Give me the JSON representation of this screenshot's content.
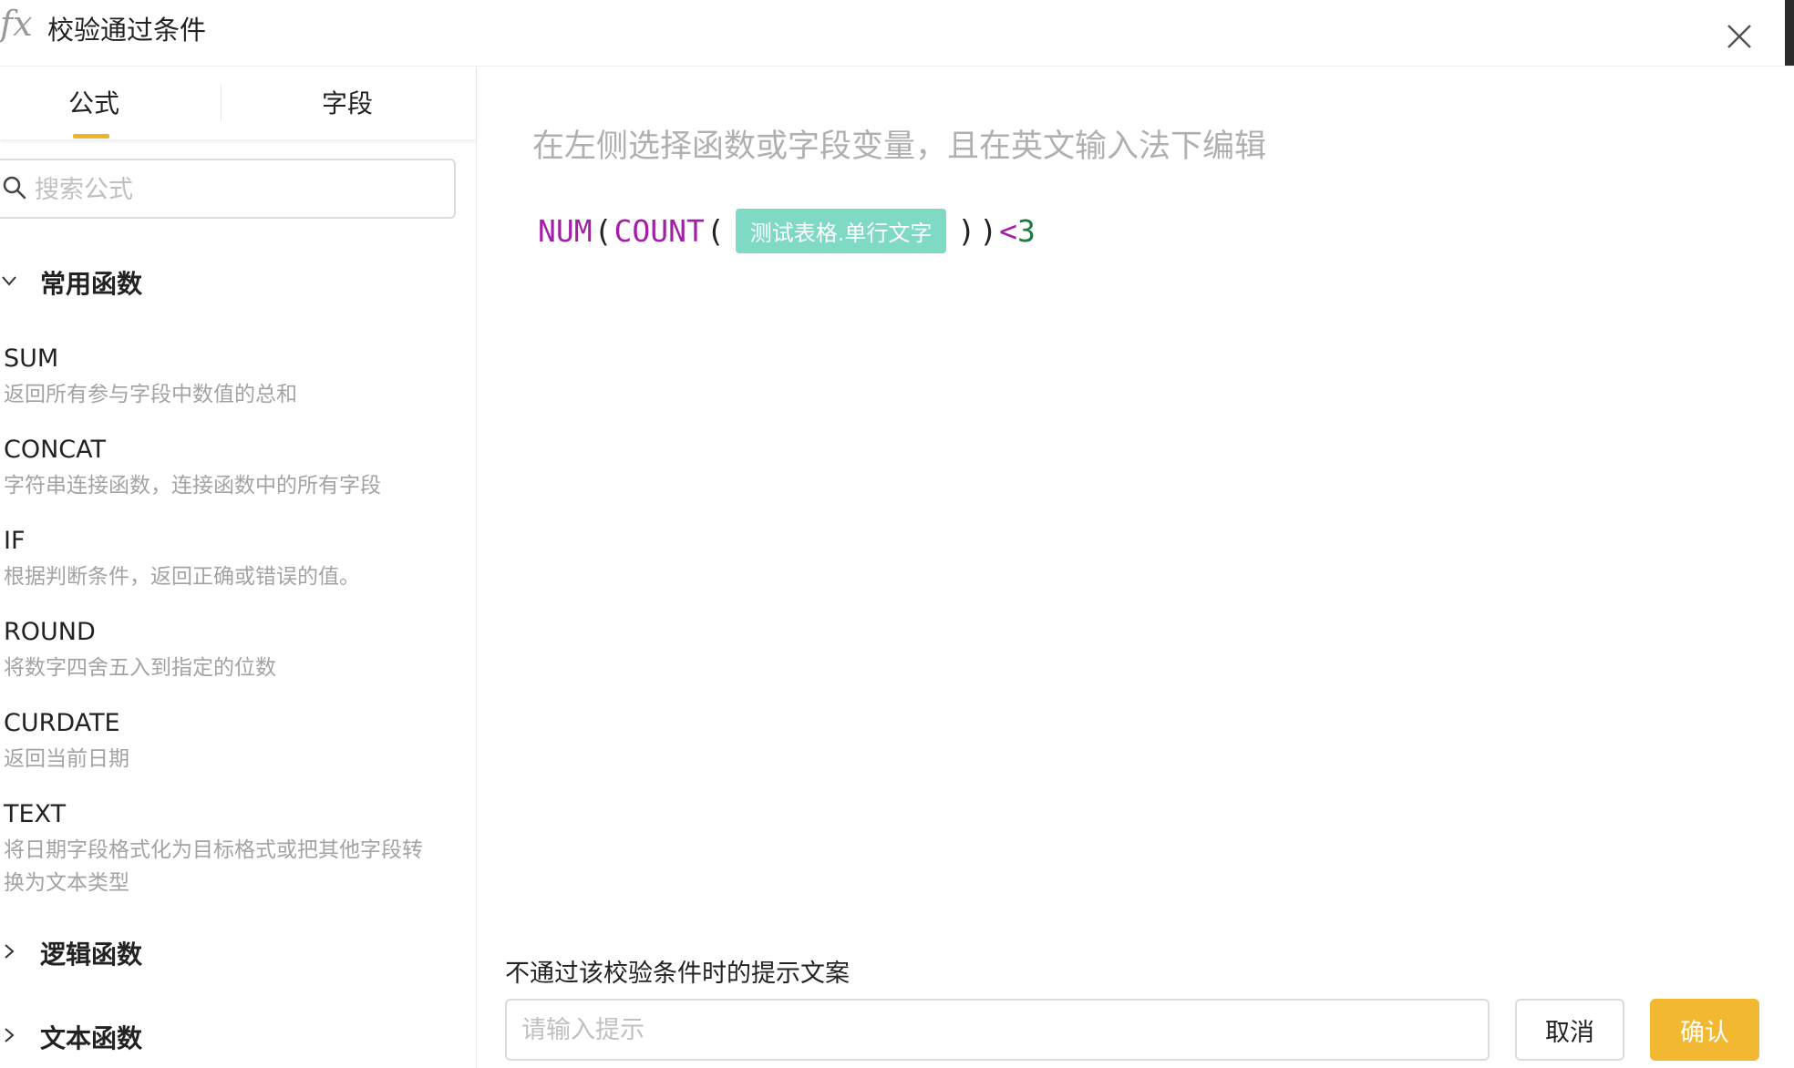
{
  "header": {
    "fx_icon": "fx",
    "title": "校验通过条件",
    "close_icon": "close-icon"
  },
  "tabs": [
    {
      "label": "公式",
      "active": true
    },
    {
      "label": "字段",
      "active": false
    }
  ],
  "search": {
    "placeholder": "搜索公式"
  },
  "groups": [
    {
      "label": "常用函数",
      "expanded": true
    },
    {
      "label": "逻辑函数",
      "expanded": false
    },
    {
      "label": "文本函数",
      "expanded": false
    }
  ],
  "functions": [
    {
      "name": "SUM",
      "desc": "返回所有参与字段中数值的总和"
    },
    {
      "name": "CONCAT",
      "desc": "字符串连接函数，连接函数中的所有字段"
    },
    {
      "name": "IF",
      "desc": "根据判断条件，返回正确或错误的值。"
    },
    {
      "name": "ROUND",
      "desc": "将数字四舍五入到指定的位数"
    },
    {
      "name": "CURDATE",
      "desc": "返回当前日期"
    },
    {
      "name": "TEXT",
      "desc": "将日期字段格式化为目标格式或把其他字段转换为文本类型"
    }
  ],
  "editor": {
    "hint": "在左侧选择函数或字段变量，且在英文输入法下编辑",
    "formula": {
      "func1": "NUM",
      "func2": "COUNT",
      "open": "(",
      "close": ")",
      "field_chip": "测试表格.单行文字",
      "operator": "<",
      "value": "3"
    }
  },
  "footer": {
    "label": "不通过该校验条件时的提示文案",
    "input_placeholder": "请输入提示",
    "cancel_label": "取消",
    "confirm_label": "确认"
  },
  "colors": {
    "accent": "#f3b832",
    "function_text": "#a21fa8",
    "number_text": "#1c7a44",
    "field_chip_bg": "#7fdac5"
  }
}
